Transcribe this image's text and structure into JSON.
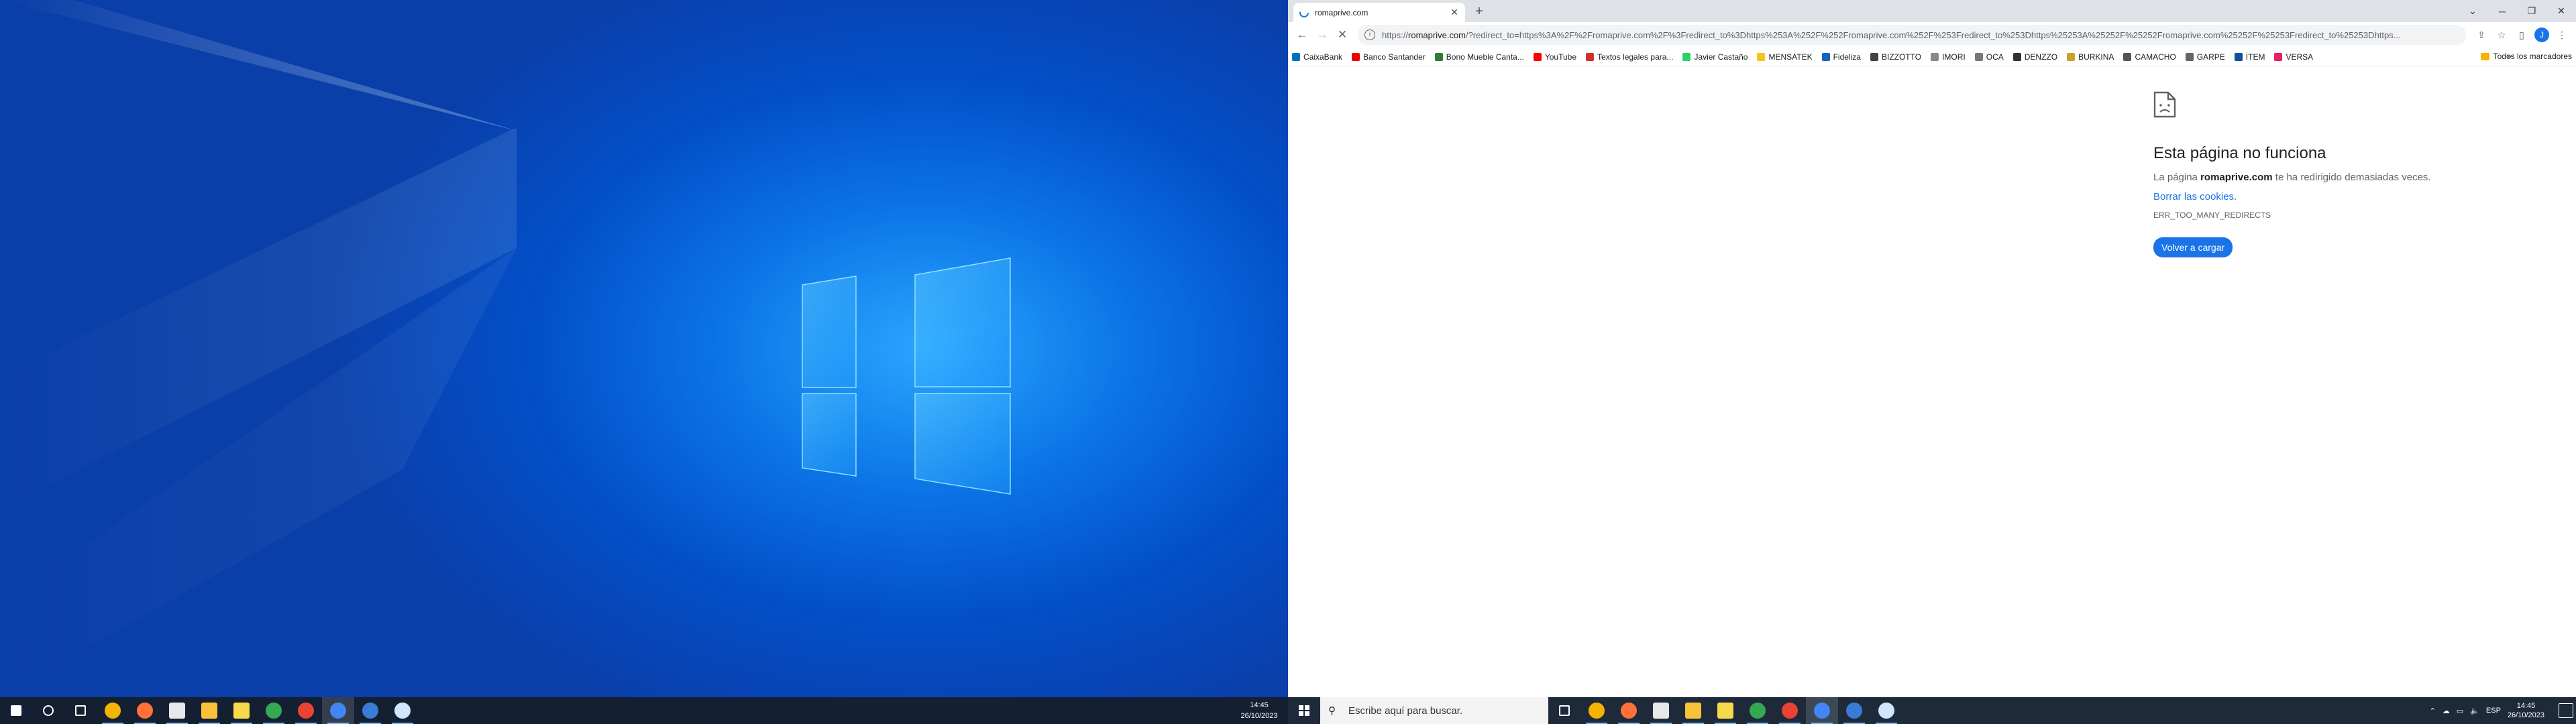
{
  "left_monitor": {
    "taskbar": {
      "apps": [
        {
          "name": "start-button-icon",
          "color": "#ffffff"
        },
        {
          "name": "search-icon",
          "color": "#ffffff"
        },
        {
          "name": "task-view-icon",
          "color": "#ffffff"
        },
        {
          "name": "chrome-icon",
          "color": "#f4b400"
        },
        {
          "name": "firefox-icon",
          "color": "#ff7139"
        },
        {
          "name": "terminal-icon",
          "color": "#e8e8e8"
        },
        {
          "name": "file-explorer-icon",
          "color": "#f8c33a"
        },
        {
          "name": "sticky-notes-icon",
          "color": "#f8d94a"
        },
        {
          "name": "chrome-profile-icon",
          "color": "#34a853"
        },
        {
          "name": "chrome-profile-red-icon",
          "color": "#ea4335"
        },
        {
          "name": "chrome-active-icon",
          "color": "#4285f4"
        },
        {
          "name": "remote-desktop-icon",
          "color": "#3a7bd5"
        },
        {
          "name": "snipping-tool-icon",
          "color": "#d0e6ff"
        }
      ],
      "time": "14:45",
      "date": "26/10/2023"
    }
  },
  "browser": {
    "tab": {
      "title": "romaprive.com"
    },
    "omnibox": {
      "url_prefix": "https://",
      "url_host": "romaprive.com",
      "url_rest": "/?redirect_to=https%3A%2F%2Fromaprive.com%2F%3Fredirect_to%3Dhttps%253A%252F%252Fromaprive.com%252F%253Fredirect_to%253Dhttps%25253A%25252F%25252Fromaprive.com%25252F%25253Fredirect_to%25253Dhttps..."
    },
    "bookmarks": [
      {
        "label": "CaixaBank",
        "color": "#0072bc"
      },
      {
        "label": "Banco Santander",
        "color": "#ec0000"
      },
      {
        "label": "Bono Mueble Canta...",
        "color": "#2e7d32"
      },
      {
        "label": "YouTube",
        "color": "#ff0000"
      },
      {
        "label": "Textos legales para...",
        "color": "#d32f2f"
      },
      {
        "label": "Javier Castaño",
        "color": "#25d366"
      },
      {
        "label": "MENSATEK",
        "color": "#f5c518"
      },
      {
        "label": "Fideliza",
        "color": "#1565c0"
      },
      {
        "label": "BIZZOTTO",
        "color": "#444444"
      },
      {
        "label": "IMORI",
        "color": "#888888"
      },
      {
        "label": "OCA",
        "color": "#777777"
      },
      {
        "label": "DENZZO",
        "color": "#333333"
      },
      {
        "label": "BURKINA",
        "color": "#c9a227"
      },
      {
        "label": "CAMACHO",
        "color": "#555555"
      },
      {
        "label": "GARPE",
        "color": "#666666"
      },
      {
        "label": "ITEM",
        "color": "#0b5394"
      },
      {
        "label": "VERSA",
        "color": "#e91e63"
      }
    ],
    "bookmarks_more": "»",
    "all_bookmarks": "Todos los marcadores",
    "profile_initial": "J"
  },
  "error_page": {
    "heading": "Esta página no funciona",
    "desc_prefix": "La página ",
    "desc_host": "romaprive.com",
    "desc_suffix": " te ha redirigido demasiadas veces.",
    "link": "Borrar las cookies.",
    "code": "ERR_TOO_MANY_REDIRECTS",
    "reload_button": "Volver a cargar"
  },
  "right_taskbar": {
    "search_placeholder": "Escribe aquí para buscar.",
    "language": "ESP",
    "time": "14:45",
    "date": "26/10/2023"
  },
  "colors": {
    "accent": "#1a73e8",
    "chrome_tabstrip": "#dee1e6"
  }
}
